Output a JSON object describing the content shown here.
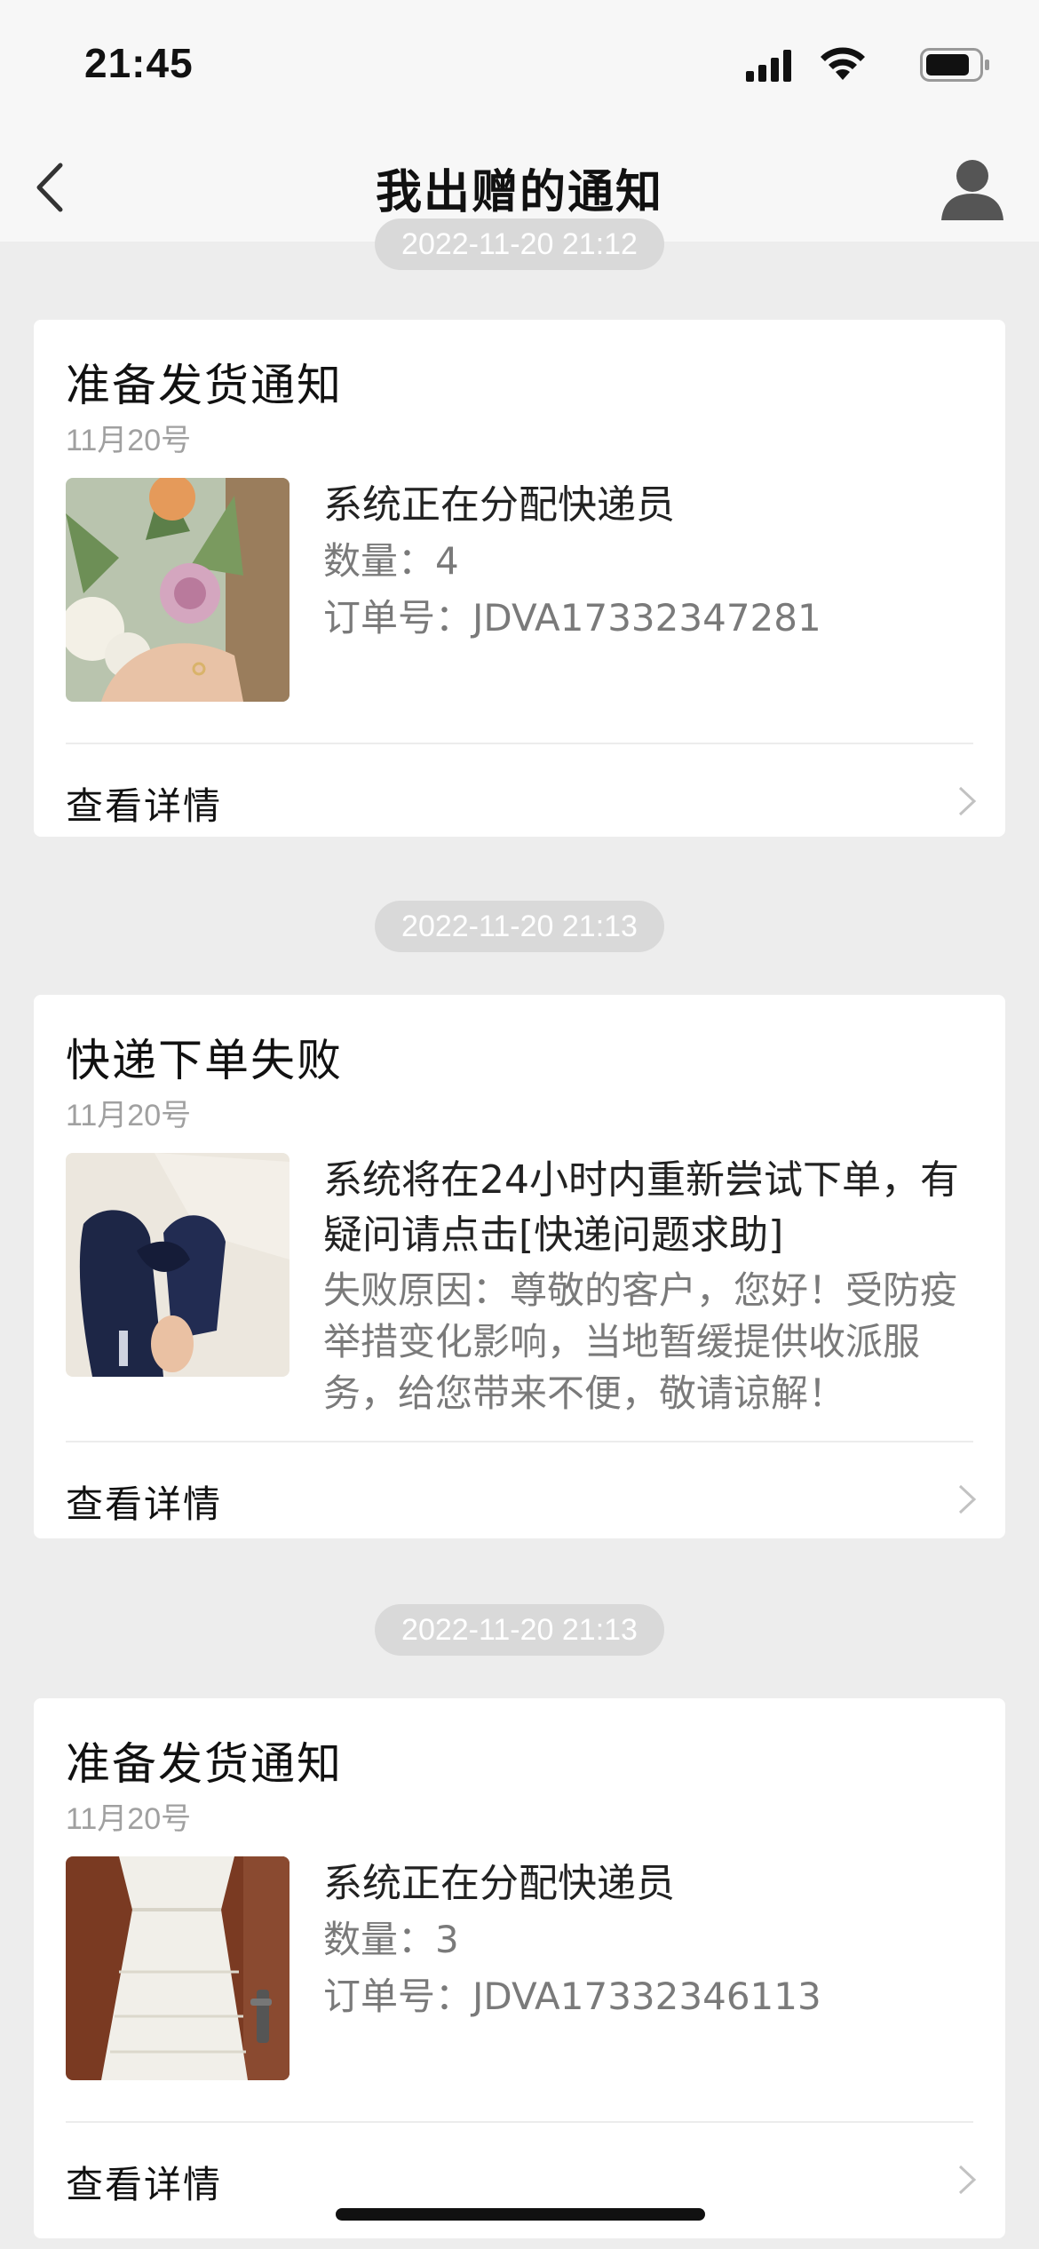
{
  "status": {
    "time": "21:45"
  },
  "nav": {
    "title": "我出赠的通知"
  },
  "timestamps": [
    "2022-11-20 21:12",
    "2022-11-20 21:13",
    "2022-11-20 21:13"
  ],
  "cards": [
    {
      "title": "准备发货通知",
      "date": "11月20号",
      "main": "系统正在分配快递员",
      "line1": "数量：4",
      "line2": "订单号：JDVA17332347281",
      "details": "查看详情",
      "thumb_icon": "flower-bouquet-photo"
    },
    {
      "title": "快递下单失败",
      "date": "11月20号",
      "main": "系统将在24小时内重新尝试下单，有疑问请点击[快递问题求助]",
      "line1": "失败原因：尊敬的客户，您好！受防疫举措变化影响，当地暂缓提供收派服务，给您带来不便，敬请谅解！",
      "details": "查看详情",
      "thumb_icon": "blue-shoes-photo"
    },
    {
      "title": "准备发货通知",
      "date": "11月20号",
      "main": "系统正在分配快递员",
      "line1": "数量：3",
      "line2": "订单号：JDVA17332346113",
      "details": "查看详情",
      "thumb_icon": "white-dress-photo"
    }
  ]
}
